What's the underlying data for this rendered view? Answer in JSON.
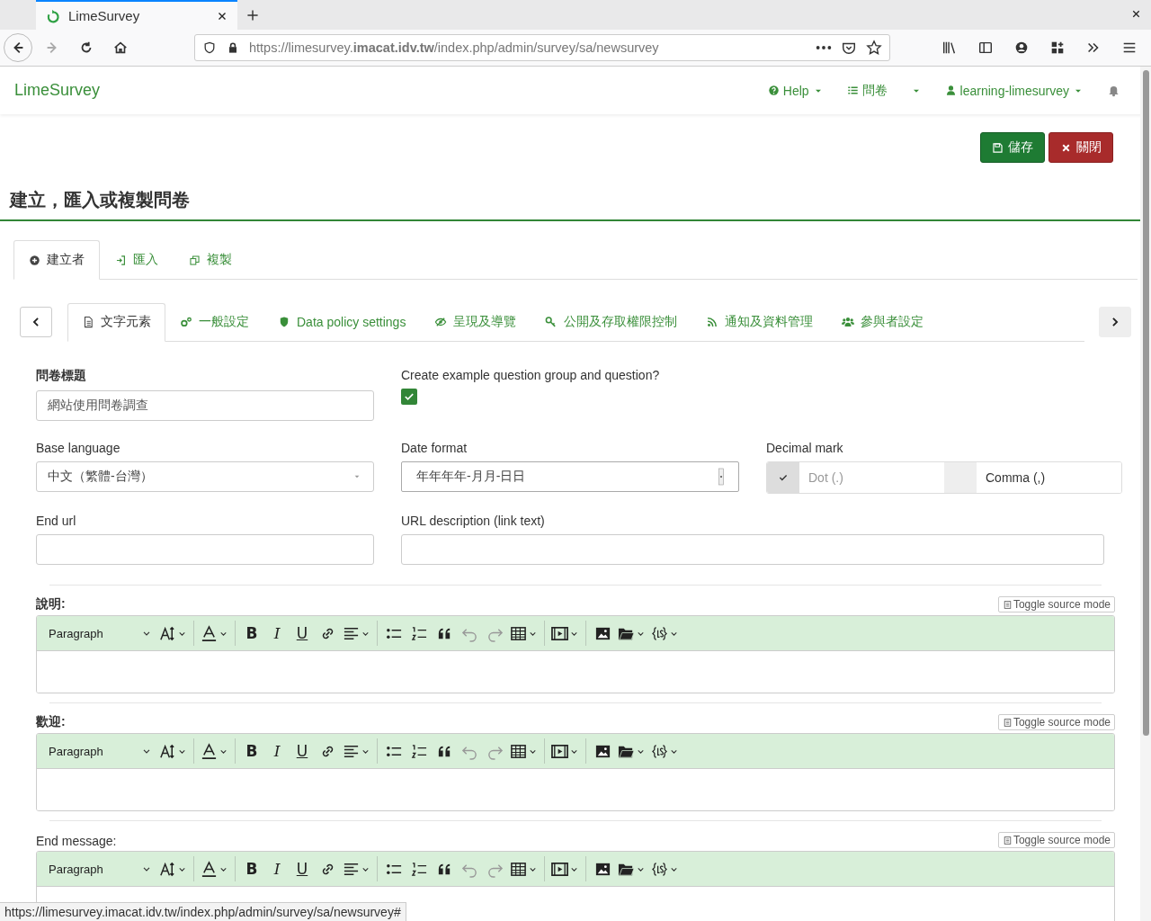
{
  "browser": {
    "tab_title": "LimeSurvey",
    "url": "https://limesurvey.**imacat.idv.tw**/index.php/admin/survey/sa/newsurvey"
  },
  "navbar": {
    "brand": "LimeSurvey",
    "items": [
      {
        "kind": "help",
        "label": "Help"
      },
      {
        "kind": "surveys",
        "label": "問卷"
      },
      {
        "kind": "user",
        "label": "learning-limesurvey"
      }
    ]
  },
  "actions": [
    {
      "kind": "save",
      "label": "儲存"
    },
    {
      "kind": "close",
      "label": "關閉"
    }
  ],
  "page_title": "建立，匯入或複製問卷",
  "top_tabs": [
    {
      "kind": "create",
      "label": "建立者",
      "selected": true
    },
    {
      "kind": "import",
      "label": "匯入",
      "selected": false
    },
    {
      "kind": "copy",
      "label": "複製",
      "selected": false
    }
  ],
  "sub_tabs": [
    {
      "kind": "text",
      "label": "文字元素",
      "selected": true
    },
    {
      "kind": "general",
      "label": "一般設定",
      "selected": false
    },
    {
      "kind": "policy",
      "label": "Data policy settings",
      "selected": false
    },
    {
      "kind": "view",
      "label": "呈現及導覽",
      "selected": false
    },
    {
      "kind": "key",
      "label": "公開及存取權限控制",
      "selected": false
    },
    {
      "kind": "feed",
      "label": "通知及資料管理",
      "selected": false
    },
    {
      "kind": "users",
      "label": "參與者設定",
      "selected": false
    }
  ],
  "form": {
    "survey_title": {
      "label": "問卷標題",
      "value": "網站使用問卷調查"
    },
    "example_group": {
      "label": "Create example question group and question?",
      "checked": true
    },
    "base_language": {
      "label": "Base language",
      "value": "中文（繁體-台灣）"
    },
    "date_format": {
      "label": "Date format",
      "value": "年年年年-月月-日日"
    },
    "decimal_mark": {
      "label": "Decimal mark",
      "options": [
        {
          "label": "Dot (.)",
          "selected": true
        },
        {
          "label": "Comma (,)",
          "selected": false
        }
      ]
    },
    "end_url": {
      "label": "End url"
    },
    "url_description": {
      "label": "URL description (link text)"
    }
  },
  "editors": [
    {
      "label": "說明:",
      "toggle": "Toggle source mode",
      "format": "Paragraph",
      "text_tools": [
        "B",
        "I",
        "U"
      ]
    },
    {
      "label": "歡迎:",
      "toggle": "Toggle source mode",
      "format": "Paragraph",
      "text_tools": [
        "B",
        "I",
        "U"
      ]
    },
    {
      "label": "End message:",
      "toggle": "Toggle source mode",
      "format": "Paragraph",
      "text_tools": [
        "B",
        "I",
        "U"
      ]
    }
  ],
  "status_bar": "https://limesurvey.imacat.idv.tw/index.php/admin/survey/sa/newsurvey#"
}
